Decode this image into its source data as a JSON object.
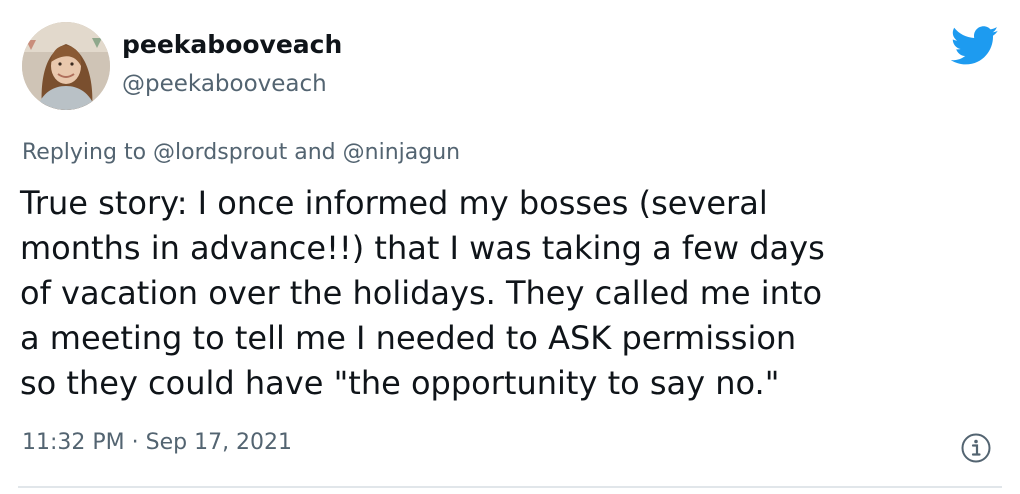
{
  "user": {
    "display_name": "peekabooveach",
    "handle": "@peekabooveach",
    "avatar_icon": "profile-photo"
  },
  "reply": {
    "prefix": "Replying to",
    "mention_1": "@lordsprout",
    "conjunction": "and",
    "mention_2": "@ninjagun"
  },
  "tweet": {
    "lines": [
      "True story: I once informed my bosses (several",
      "months in advance!!) that I was taking a few days",
      "of vacation over the holidays. They called me into",
      "a meeting to tell me I needed to ASK permission",
      "so they could have \"the opportunity to say no.\""
    ]
  },
  "meta": {
    "timestamp": "11:32 PM · Sep 17, 2021"
  },
  "icons": {
    "brand": "twitter-bird-icon",
    "info": "info-icon"
  },
  "colors": {
    "twitter_blue": "#1d9bf0",
    "text_primary": "#0f1419",
    "text_secondary": "#536471",
    "divider": "#e1e6ea"
  }
}
